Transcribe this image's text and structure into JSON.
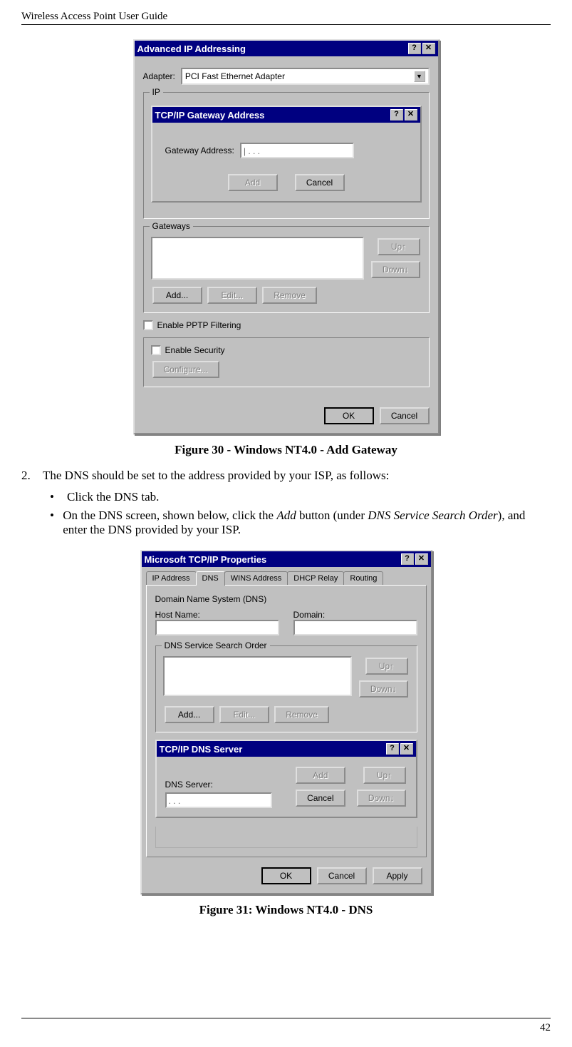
{
  "header": {
    "title": "Wireless Access Point User Guide"
  },
  "fig1": {
    "outer_title": "Advanced IP Addressing",
    "adapter_label": "Adapter:",
    "adapter_value": "PCI Fast Ethernet Adapter",
    "ip_group": "IP",
    "inner_title": "TCP/IP Gateway Address",
    "gateway_label": "Gateway Address:",
    "ip_placeholder": "|    .        .        .",
    "add_btn": "Add",
    "cancel_btn": "Cancel",
    "gateways_group": "Gateways",
    "up_btn": "Up↑",
    "down_btn": "Down↓",
    "add_ellipsis": "Add...",
    "edit_ellipsis": "Edit...",
    "remove_btn": "Remove",
    "pptp_label": "Enable PPTP Filtering",
    "security_label": "Enable Security",
    "configure_btn": "Configure...",
    "ok_btn": "OK",
    "help_glyph": "?",
    "close_glyph": "✕",
    "caption": "Figure 30 - Windows NT4.0 - Add Gateway"
  },
  "body": {
    "step_num": "2.",
    "step_text": "The DNS should be set to the address provided by your ISP, as follows:",
    "bullet1": "Click the DNS tab.",
    "bullet2a": "On the DNS screen, shown below, click the ",
    "bullet2b": "Add",
    "bullet2c": " button (under ",
    "bullet2d": "DNS Service Search Order",
    "bullet2e": "), and enter the DNS provided by your ISP."
  },
  "fig2": {
    "outer_title": "Microsoft TCP/IP Properties",
    "tabs": {
      "ip": "IP Address",
      "dns": "DNS",
      "wins": "WINS Address",
      "dhcp": "DHCP Relay",
      "routing": "Routing"
    },
    "dns_group": "Domain Name System (DNS)",
    "host_label": "Host Name:",
    "domain_label": "Domain:",
    "search_group": "DNS Service Search Order",
    "up_btn": "Up↑",
    "down_btn": "Down↓",
    "add_ellipsis": "Add...",
    "edit_ellipsis": "Edit...",
    "remove_btn": "Remove",
    "inner_title": "TCP/IP DNS Server",
    "dns_server_label": "DNS Server:",
    "ip_placeholder": "      .        .        .",
    "add_btn": "Add",
    "cancel_btn": "Cancel",
    "ok_btn": "OK",
    "apply_btn": "Apply",
    "help_glyph": "?",
    "close_glyph": "✕",
    "caption": "Figure 31: Windows NT4.0 - DNS"
  },
  "footer": {
    "page": "42"
  }
}
